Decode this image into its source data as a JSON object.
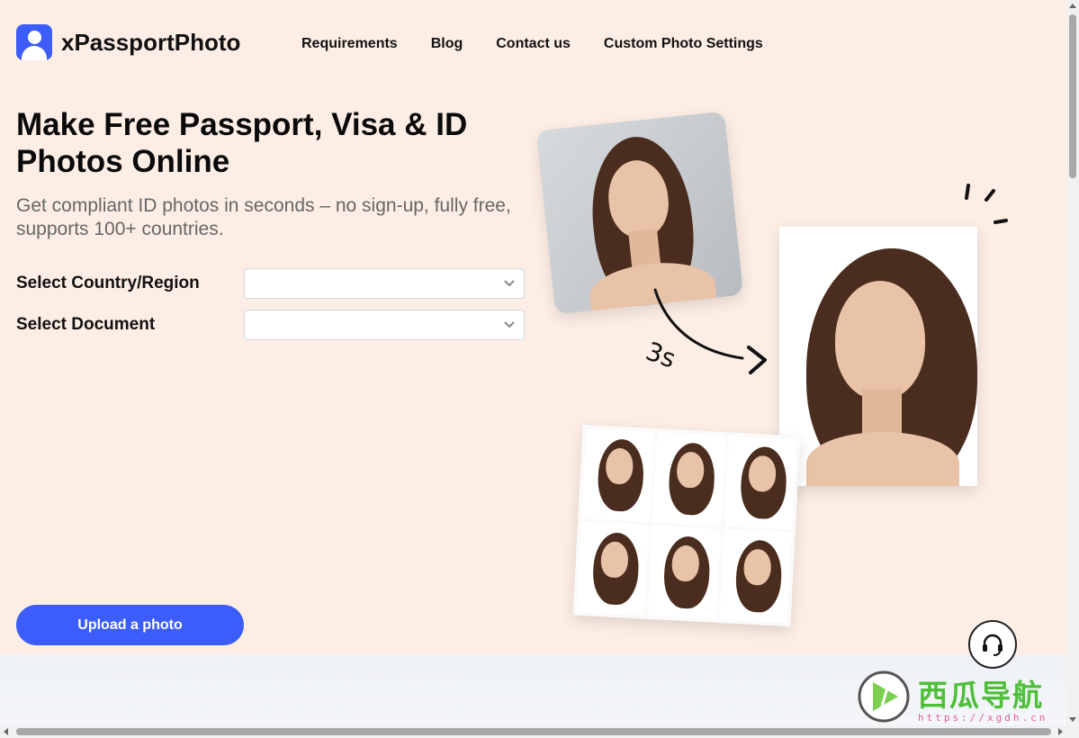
{
  "app": {
    "brand": "xPassportPhoto",
    "brand_color": "#3d5dfa"
  },
  "nav": {
    "items": [
      {
        "label": "Requirements"
      },
      {
        "label": "Blog"
      },
      {
        "label": "Contact us"
      },
      {
        "label": "Custom Photo Settings"
      }
    ]
  },
  "hero": {
    "title": "Make Free Passport, Visa & ID Photos Online",
    "subtitle": "Get compliant ID photos in seconds – no sign-up, fully free, supports 100+ countries."
  },
  "form": {
    "country_label": "Select Country/Region",
    "country_value": "",
    "document_label": "Select Document",
    "document_value": ""
  },
  "upload": {
    "label": "Upload a photo"
  },
  "illustration": {
    "timer_label": "3s"
  },
  "support": {
    "icon": "headset-icon"
  },
  "watermark": {
    "text": "西瓜导航",
    "url": "https://xgdh.cn"
  }
}
